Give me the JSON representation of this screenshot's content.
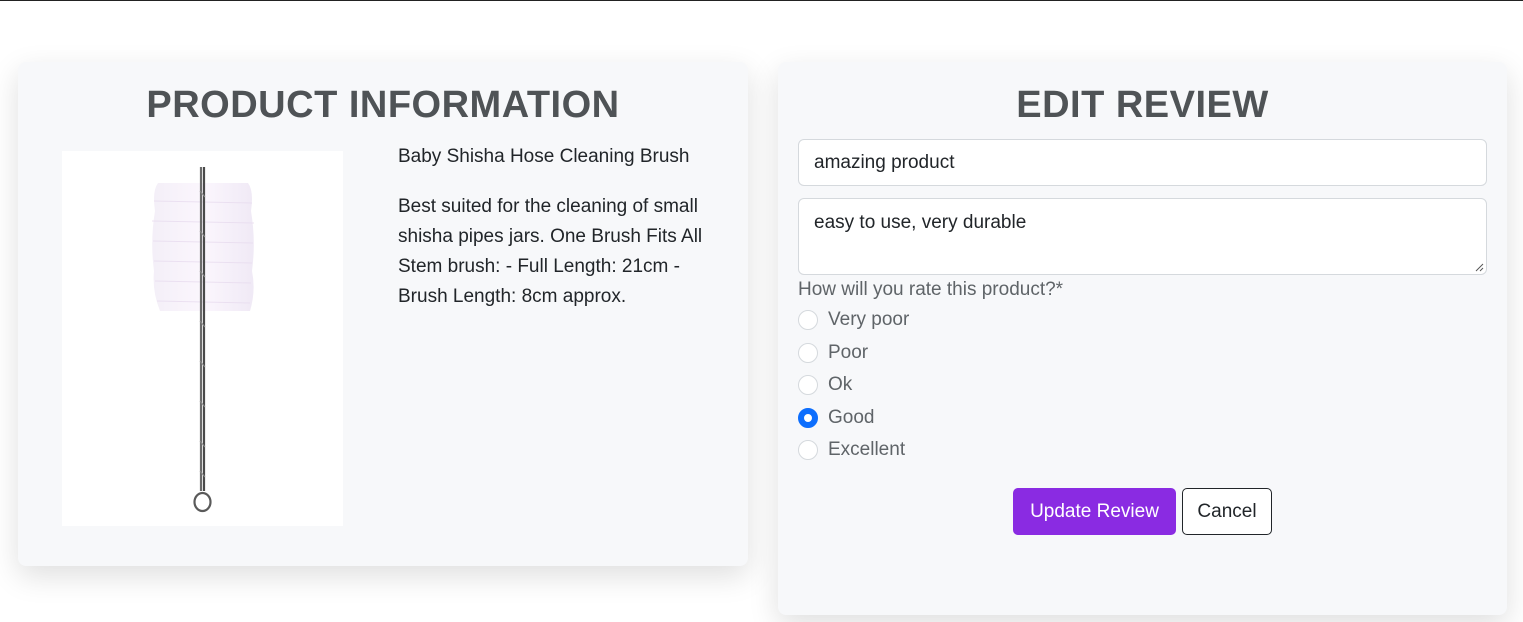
{
  "product": {
    "heading": "PRODUCT INFORMATION",
    "name": "Baby Shisha Hose Cleaning Brush",
    "description": "Best suited for the cleaning of small shisha pipes jars. One Brush Fits All Stem brush: - Full Length: 21cm - Brush Length: 8cm approx."
  },
  "review": {
    "heading": "EDIT REVIEW",
    "title_value": "amazing product",
    "body_value": "easy to use, very durable",
    "rating_prompt": "How will you rate this product?*",
    "rating_options": [
      {
        "label": "Very poor",
        "checked": false
      },
      {
        "label": "Poor",
        "checked": false
      },
      {
        "label": "Ok",
        "checked": false
      },
      {
        "label": "Good",
        "checked": true
      },
      {
        "label": "Excellent",
        "checked": false
      }
    ],
    "update_label": "Update Review",
    "cancel_label": "Cancel"
  },
  "colors": {
    "accent": "#8a2be2",
    "radio_checked": "#0d6efd",
    "card_bg": "#f7f8fa"
  }
}
